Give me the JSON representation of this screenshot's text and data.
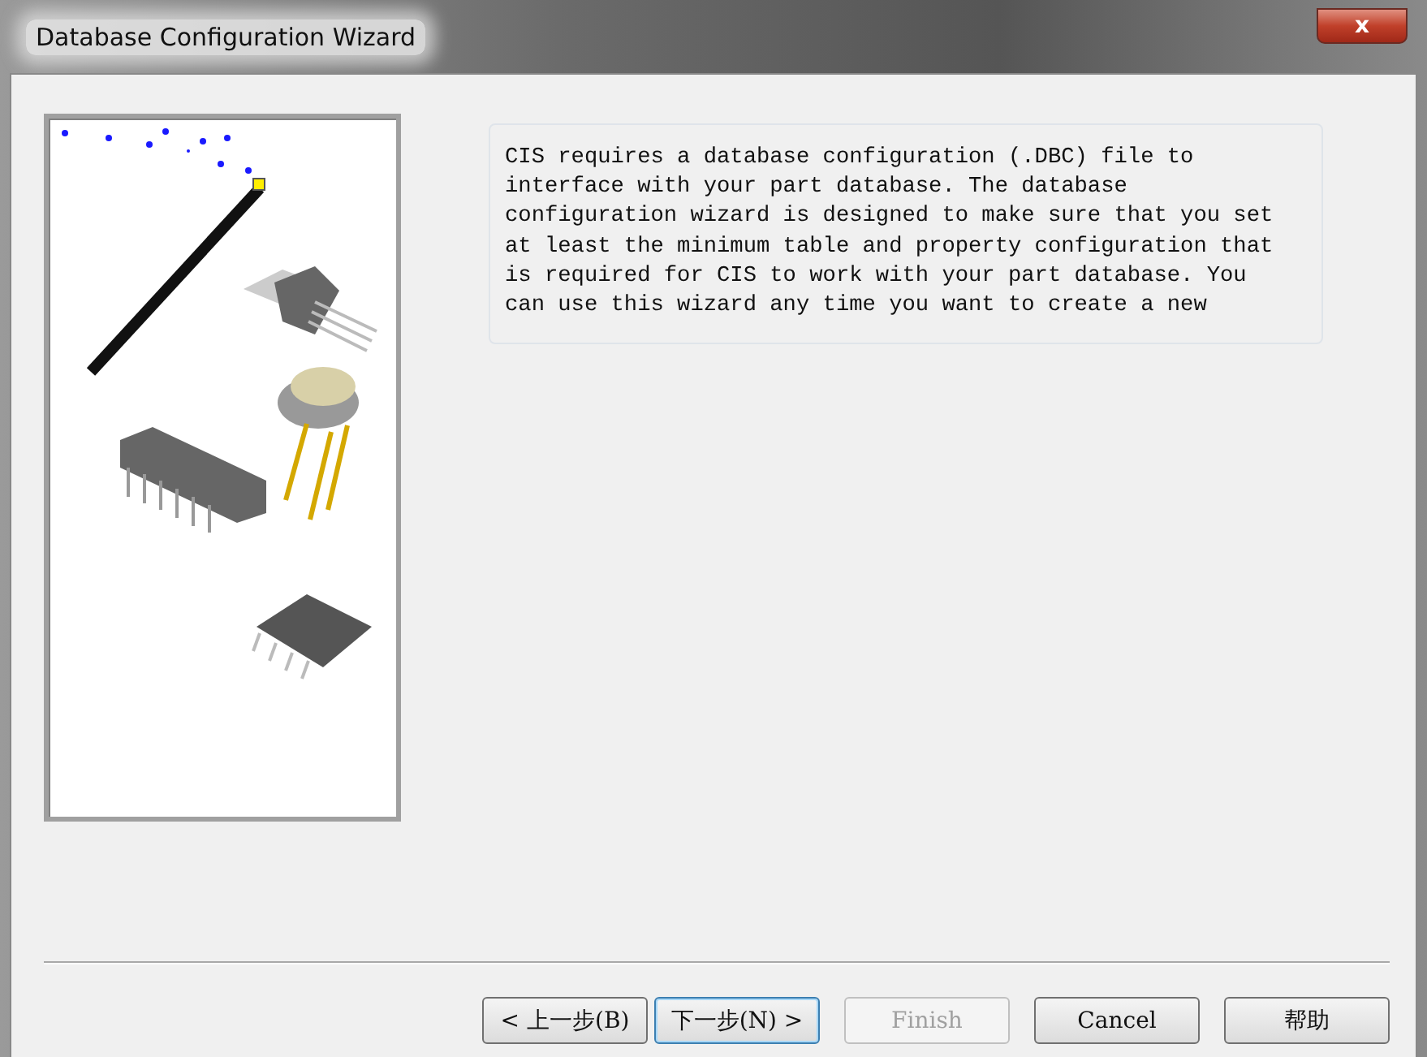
{
  "window": {
    "title": "Database Configuration Wizard",
    "close_label": "x"
  },
  "intro_text": "CIS requires a database configuration (.DBC) file to interface with your part database. The database configuration wizard is designed to make sure that you set at least the minimum table and property configuration that is required for CIS to work with your part database. You can use this wizard any time you want to create a new",
  "buttons": [
    {
      "label": "< 上一步(B)",
      "disabled": false,
      "focused": false
    },
    {
      "label": "下一步(N) >",
      "disabled": false,
      "focused": true
    },
    {
      "label": "Finish",
      "disabled": true,
      "focused": false
    },
    {
      "label": "Cancel",
      "disabled": false,
      "focused": false
    },
    {
      "label": "帮助",
      "disabled": false,
      "focused": false
    }
  ]
}
